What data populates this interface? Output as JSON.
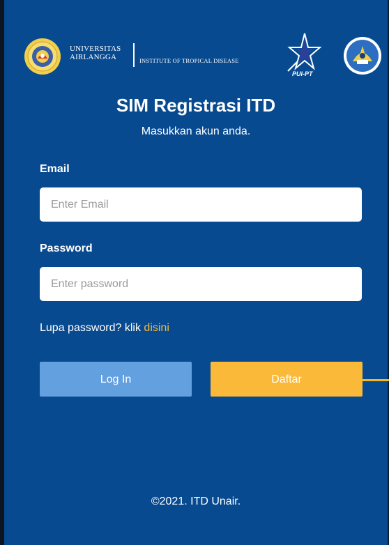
{
  "header": {
    "university_line1": "UNIVERSITAS",
    "university_line2": "AIRLANGGA",
    "institute": "INSTITUTE OF TROPICAL DISEASE",
    "puipt_text": "PUI-PT"
  },
  "title": "SIM Registrasi ITD",
  "subtitle": "Masukkan akun anda.",
  "form": {
    "email_label": "Email",
    "email_placeholder": "Enter Email",
    "password_label": "Password",
    "password_placeholder": "Enter password",
    "forgot_text": "Lupa password? klik ",
    "forgot_link": "disini",
    "login_label": "Log In",
    "register_label": "Daftar"
  },
  "footer": "©2021. ITD Unair.",
  "colors": {
    "background": "#084a8f",
    "login_button": "#63a0e0",
    "register_button": "#fbb93a",
    "link": "#f5b83d"
  }
}
